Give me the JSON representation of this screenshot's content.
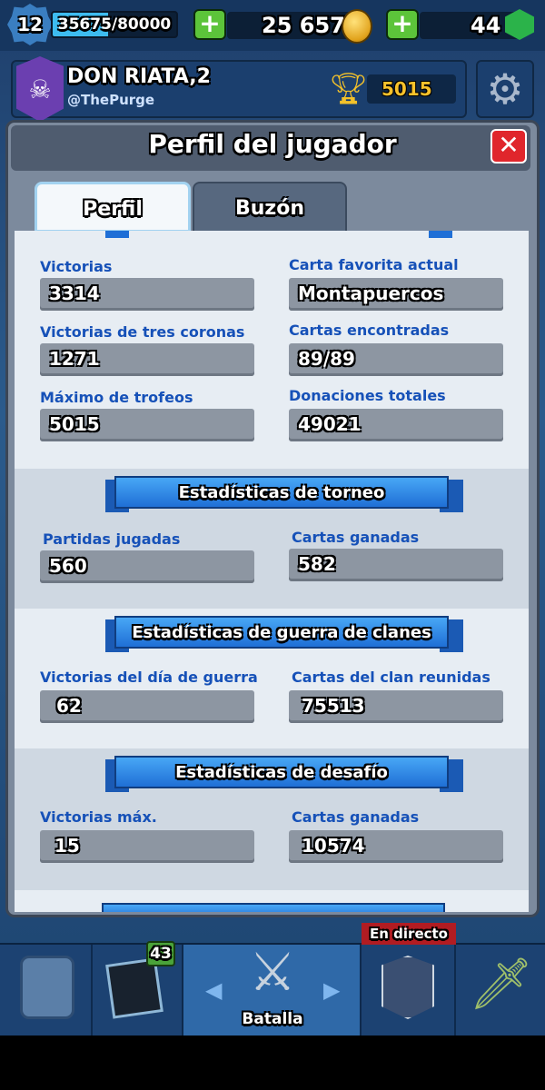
{
  "topbar": {
    "level": "12",
    "xp_text": "35675/80000",
    "xp_fraction": 0.446,
    "gold": "25 657",
    "gems": "44"
  },
  "player": {
    "name": "DON RIATA,2",
    "clan": "@ThePurge",
    "trophies": "5015"
  },
  "modal": {
    "title": "Perfil del jugador",
    "tabs": [
      "Perfil",
      "Buzón"
    ],
    "close_icon": "close-x"
  },
  "stats": {
    "wins_label": "Victorias",
    "wins": "3314",
    "fav_label": "Carta favorita actual",
    "fav": "Montapuercos",
    "three_crown_label": "Victorias de tres coronas",
    "three_crown": "1271",
    "cards_found_label": "Cartas encontradas",
    "cards_found": "89/89",
    "max_trophies_label": "Máximo de trofeos",
    "max_trophies": "5015",
    "donations_label": "Donaciones totales",
    "donations": "49021"
  },
  "tournament": {
    "title": "Estadísticas de torneo",
    "played_label": "Partidas jugadas",
    "played": "560",
    "won_label": "Cartas ganadas",
    "won": "582"
  },
  "clan_war": {
    "title": "Estadísticas de guerra de clanes",
    "wins_label": "Victorias del día de guerra",
    "wins": "62",
    "cards_label": "Cartas del clan reunidas",
    "cards": "75513"
  },
  "challenge": {
    "title": "Estadísticas de desafío",
    "max_wins_label": "Victorias máx.",
    "max_wins": "15",
    "cards_label": "Cartas ganadas",
    "cards": "10574"
  },
  "nav": {
    "cards_badge": "43",
    "battle_label": "Batalla",
    "live_label": "En directo",
    "colors": {
      "accent": "#1651b8",
      "live": "#b11c22"
    }
  }
}
